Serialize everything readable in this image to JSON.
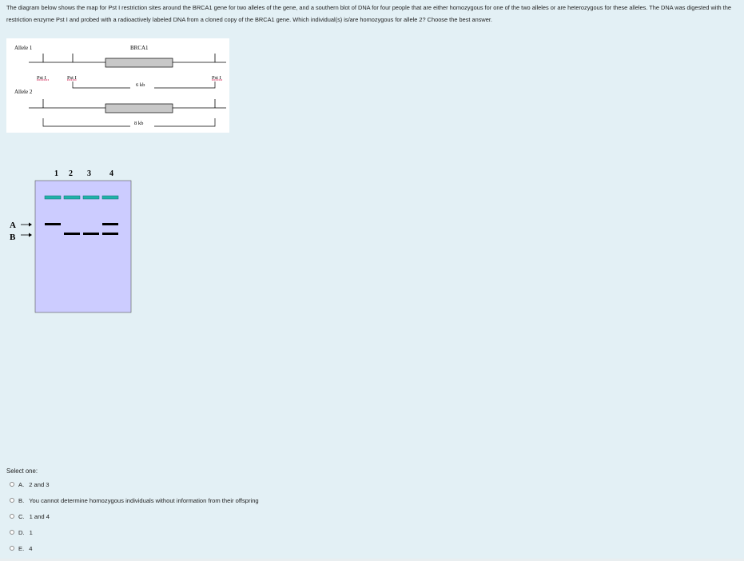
{
  "question": {
    "text": "The diagram below shows the map for Pst I restriction sites around the BRCA1 gene for two alleles of the gene, and a southern blot of DNA for four people that are either homozygous for one of the two alleles or are heterozygous for these alleles. The DNA was digested with the restriction enzyme Pst I and probed with a radioactively labeled DNA from a cloned copy of the BRCA1 gene. Which individual(s) is/are homozygous for allele 2? Choose the best answer."
  },
  "map": {
    "allele1_label": "Allele 1",
    "allele2_label": "Allele 2",
    "gene_label": "BRCA1",
    "site_label": "Pst I",
    "allele1_fragment": "6 kb",
    "allele2_fragment": "8 kb"
  },
  "blot": {
    "lanes": [
      "1",
      "2",
      "3",
      "4"
    ],
    "band_labels": [
      "A",
      "B"
    ],
    "lane_bands": {
      "1": [
        "A"
      ],
      "2": [
        "B"
      ],
      "3": [
        "B"
      ],
      "4": [
        "A",
        "B"
      ]
    },
    "colors": {
      "gel": "#ccccff",
      "well": "#20b2aa",
      "band": "#000000"
    }
  },
  "select_one": "Select one:",
  "options": [
    {
      "letter": "A.",
      "text": "2 and 3"
    },
    {
      "letter": "B.",
      "text": "You cannot determine homozygous individuals without information from their offspring"
    },
    {
      "letter": "C.",
      "text": "1 and 4"
    },
    {
      "letter": "D.",
      "text": "1"
    },
    {
      "letter": "E.",
      "text": "4"
    }
  ]
}
